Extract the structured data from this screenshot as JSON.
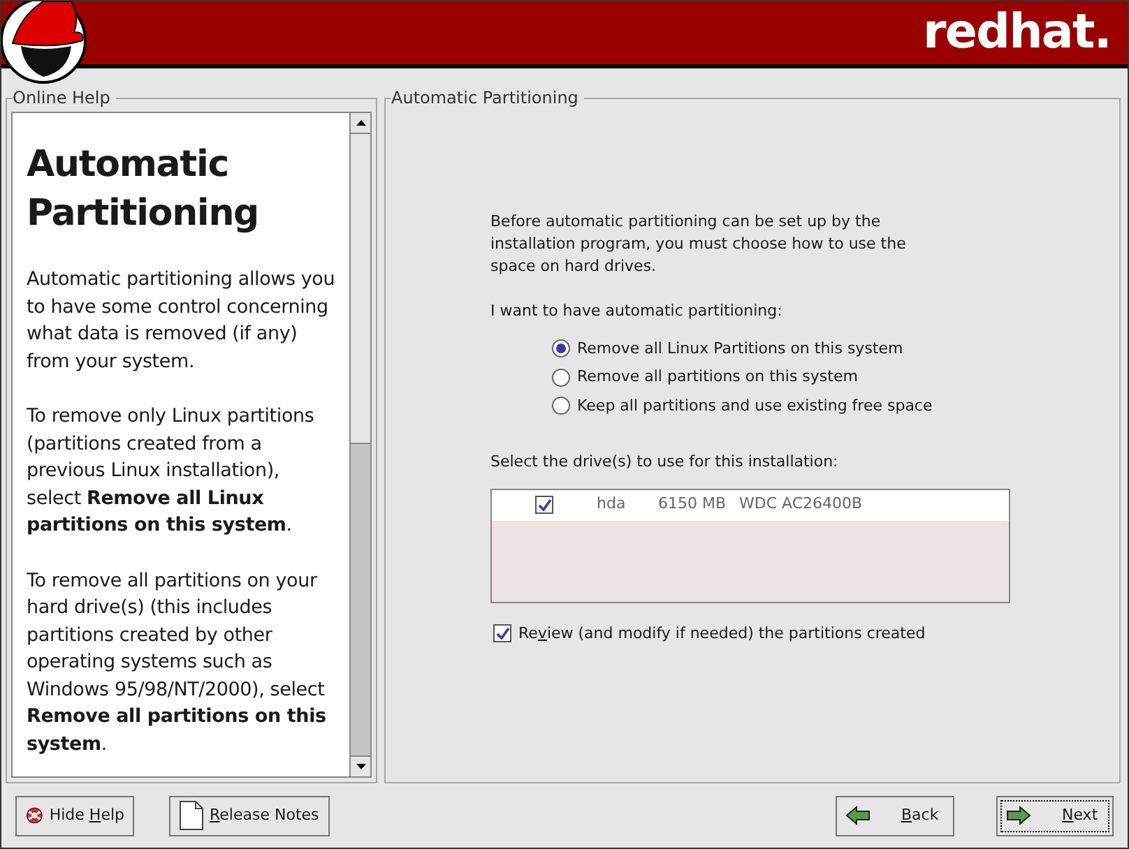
{
  "header": {
    "brand": "redhat."
  },
  "help": {
    "title": "Online Help",
    "heading": "Automatic Partitioning",
    "paragraphs": [
      "Automatic partitioning allows you to have some control concerning what data is removed (if any) from your system.",
      "To remove only Linux partitions (partitions created from a previous Linux installation), select **Remove all Linux partitions on this system**.",
      "To remove all partitions on your hard drive(s) (this includes partitions created by other operating systems such as Windows 95/98/NT/2000), select **Remove all partitions on this system**."
    ]
  },
  "main": {
    "title": "Automatic Partitioning",
    "intro": "Before automatic partitioning can be set up by the installation program, you must choose how to use the space on hard drives.",
    "question": "I want to have automatic partitioning:",
    "options": [
      {
        "label": "Remove all Linux Partitions on this system",
        "selected": true
      },
      {
        "label": "Remove all partitions on this system",
        "selected": false
      },
      {
        "label": "Keep all partitions and use existing free space",
        "selected": false
      }
    ],
    "drives_label": "Select the drive(s) to use for this installation:",
    "drives": [
      {
        "checked": true,
        "name": "hda",
        "size": "6150 MB",
        "model": "WDC AC26400B"
      }
    ],
    "review": {
      "label": {
        "pre": "Re",
        "key": "v",
        "post": "iew (and modify if needed) the partitions created"
      },
      "checked": true
    }
  },
  "buttons": [
    {
      "kind": "help",
      "label": {
        "pre": "Hide ",
        "key": "H",
        "post": "elp"
      }
    },
    {
      "kind": "notes",
      "label": {
        "key": "R",
        "post": "elease Notes"
      }
    },
    {
      "kind": "back",
      "label": {
        "key": "B",
        "post": "ack"
      }
    },
    {
      "kind": "next",
      "label": {
        "key": "N",
        "post": "ext"
      }
    }
  ]
}
